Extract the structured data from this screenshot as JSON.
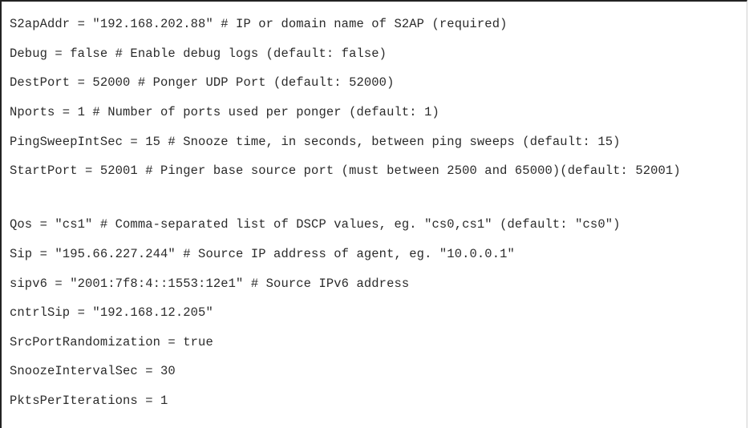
{
  "config_lines": [
    "S2apAddr = \"192.168.202.88\" # IP or domain name of S2AP (required)",
    "Debug = false # Enable debug logs (default: false)",
    "DestPort = 52000 # Ponger UDP Port (default: 52000)",
    "Nports = 1 # Number of ports used per ponger (default: 1)",
    "PingSweepIntSec = 15 # Snooze time, in seconds, between ping sweeps (default: 15)",
    "StartPort = 52001 # Pinger base source port (must between 2500 and 65000)(default: 52001)",
    "Qos = \"cs1\" # Comma-separated list of DSCP values, eg. \"cs0,cs1\" (default: \"cs0\")",
    "Sip = \"195.66.227.244\" # Source IP address of agent, eg. \"10.0.0.1\"",
    "sipv6 = \"2001:7f8:4::1553:12e1\" # Source IPv6 address",
    "cntrlSip = \"192.168.12.205\"",
    "SrcPortRandomization = true",
    "SnoozeIntervalSec = 30",
    "PktsPerIterations = 1"
  ]
}
